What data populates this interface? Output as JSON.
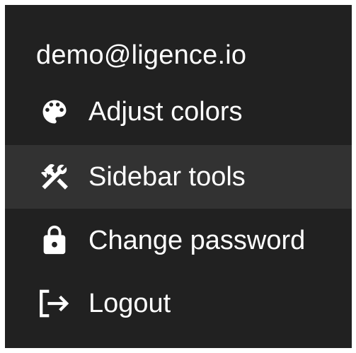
{
  "menu": {
    "account_email": "demo@ligence.io",
    "highlight_color": "#323232",
    "background_color": "#212121",
    "items": [
      {
        "label": "Adjust colors",
        "icon": "palette-icon",
        "highlighted": false
      },
      {
        "label": "Sidebar tools",
        "icon": "tools-icon",
        "highlighted": true
      },
      {
        "label": "Change password",
        "icon": "lock-icon",
        "highlighted": false
      },
      {
        "label": "Logout",
        "icon": "logout-icon",
        "highlighted": false
      }
    ]
  }
}
